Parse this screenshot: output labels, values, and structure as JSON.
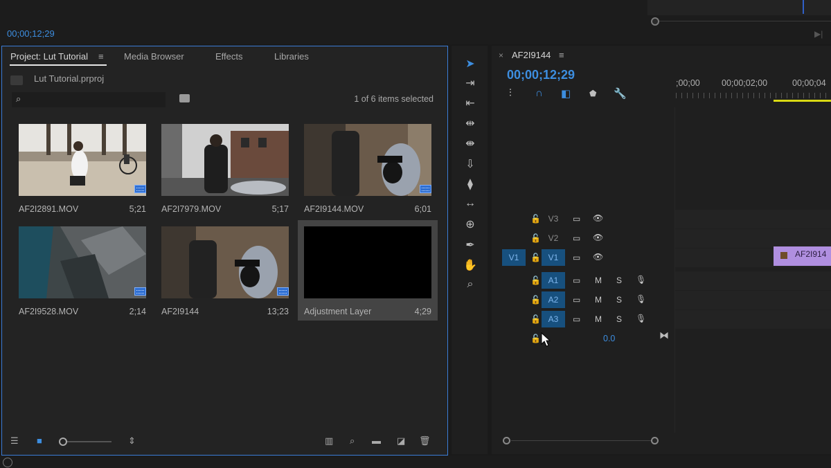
{
  "top_timecode": "00;00;12;29",
  "project": {
    "tabs": [
      "Project: Lut Tutorial",
      "Media Browser",
      "Effects",
      "Libraries"
    ],
    "menu_icon": "≡",
    "file_name": "Lut Tutorial.prproj",
    "items_selected": "1 of 6 items selected",
    "clips": [
      {
        "name": "AF2I2891.MOV",
        "duration": "5;21"
      },
      {
        "name": "AF2I7979.MOV",
        "duration": "5;17"
      },
      {
        "name": "AF2I9144.MOV",
        "duration": "6;01"
      },
      {
        "name": "AF2I9528.MOV",
        "duration": "2;14"
      },
      {
        "name": "AF2I9144",
        "duration": "13;23"
      },
      {
        "name": "Adjustment Layer",
        "duration": "4;29"
      }
    ]
  },
  "timeline": {
    "close_icon": "×",
    "title": "AF2I9144",
    "menu_icon": "≡",
    "timecode": "00;00;12;29",
    "ruler_labels": [
      ";00;00",
      "00;00;02;00",
      "00;00;04"
    ],
    "video_tracks": [
      {
        "label": "V3",
        "source": ""
      },
      {
        "label": "V2",
        "source": ""
      },
      {
        "label": "V1",
        "source": "V1"
      }
    ],
    "audio_tracks": [
      {
        "label": "A1",
        "m": "M",
        "s": "S"
      },
      {
        "label": "A2",
        "m": "M",
        "s": "S"
      },
      {
        "label": "A3",
        "m": "M",
        "s": "S"
      }
    ],
    "master_value": "0.0",
    "clip_label": "AF2I914"
  },
  "colors": {
    "accent_blue": "#3d8ee0",
    "panel_border": "#3b7dd8",
    "track_on": "#17507e",
    "clip_purple": "#b08fe0",
    "work_area": "#d9d914"
  }
}
